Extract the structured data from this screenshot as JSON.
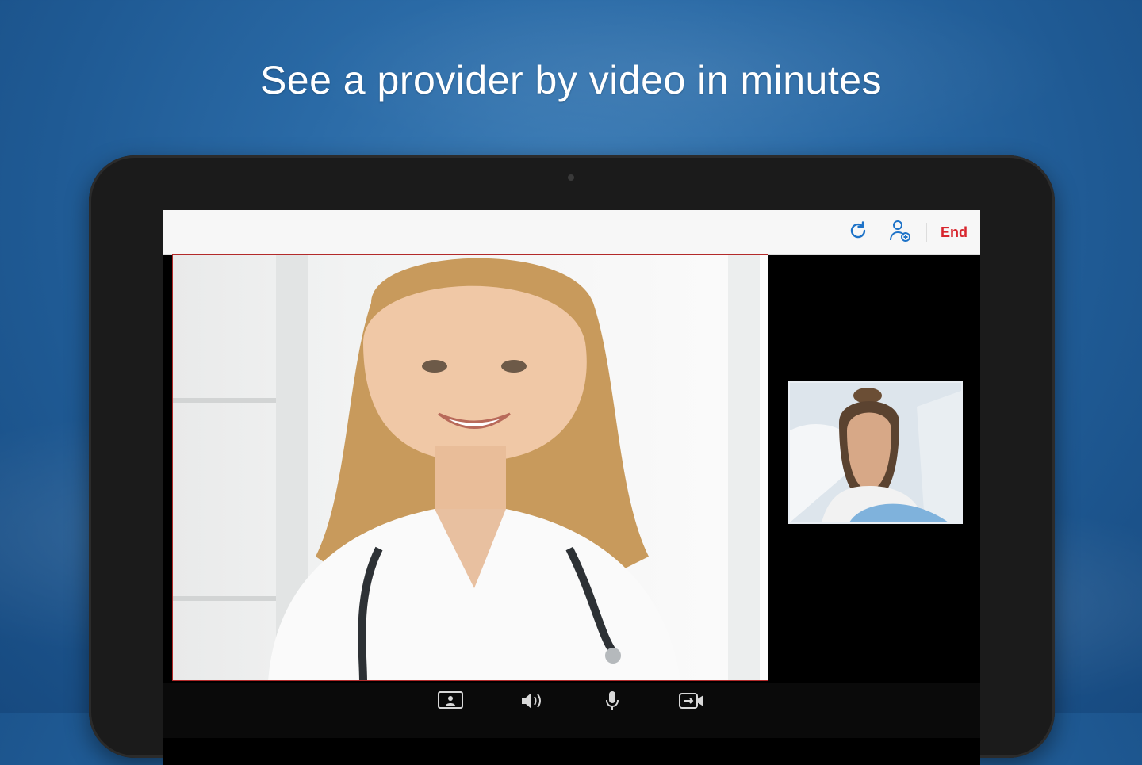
{
  "headline": "See a provider by video in minutes",
  "toolbar": {
    "refresh_icon": "refresh-icon",
    "add_participant_icon": "add-participant-icon",
    "end_label": "End"
  },
  "call": {
    "remote_video": "provider",
    "self_video": "patient"
  },
  "controls": {
    "items": [
      "screen-share-icon",
      "speaker-icon",
      "microphone-icon",
      "camera-toggle-icon"
    ]
  },
  "colors": {
    "accent": "#1e73c8",
    "end": "#d8262e",
    "background": "#2a6aa6"
  }
}
